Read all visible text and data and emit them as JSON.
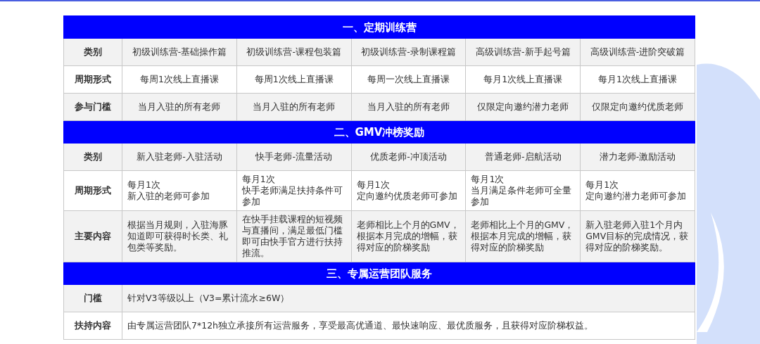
{
  "sections": [
    {
      "title": "一、定期训练营",
      "rows": [
        {
          "label": "类别",
          "kind": "centered",
          "cells": [
            "初级训练营-基础操作篇",
            "初级训练营-课程包装篇",
            "初级训练营-录制课程篇",
            "高级训练营-新手起号篇",
            "高级训练营-进阶突破篇"
          ]
        },
        {
          "label": "周期形式",
          "kind": "centered",
          "cells": [
            "每周1次线上直播课",
            "每周1次线上直播课",
            "每周一次线上直播课",
            "每月1次线上直播课",
            "每月1次线上直播课"
          ]
        },
        {
          "label": "参与门槛",
          "kind": "centered",
          "cells": [
            "当月入驻的所有老师",
            "当月入驻的所有老师",
            "当月入驻的所有老师",
            "仅限定向邀约潜力老师",
            "仅限定向邀约优质老师"
          ]
        }
      ]
    },
    {
      "title": "二、GMV冲榜奖励",
      "rows": [
        {
          "label": "类别",
          "kind": "centered",
          "cells": [
            "新入驻老师-入驻活动",
            "快手老师-流量活动",
            "优质老师-冲顶活动",
            "普通老师-启航活动",
            "潜力老师-激励活动"
          ]
        },
        {
          "label": "周期形式",
          "kind": "left",
          "cells": [
            [
              "每月1次",
              "新入驻的老师可参加"
            ],
            [
              "每月1次",
              "快手老师满足扶持条件可参加"
            ],
            [
              "每月1次",
              "定向邀约优质老师可参加"
            ],
            [
              "每月1次",
              "当月满足条件老师可全量参加"
            ],
            [
              "每月1次",
              "定向邀约潜力老师可参加"
            ]
          ]
        },
        {
          "label": "主要内容",
          "kind": "left",
          "cells": [
            "根据当月规则，入驻海豚知道即可获得时长类、礼包类等奖励。",
            "在快手挂载课程的短视频与直播间，满足最低门槛即可由快手官方进行扶持推流。",
            "老师相比上个月的GMV，根据本月完成的增幅，获得对应的阶梯奖励",
            "老师相比上个月的GMV，根据本月完成的增幅，获得对应的阶梯奖励",
            "新入驻老师入驻1个月内GMV目标的完成情况，获得对应的阶梯奖励。"
          ]
        }
      ]
    },
    {
      "title": "三、专属运营团队服务",
      "rows": [
        {
          "label": "门槛",
          "kind": "left",
          "cells": [
            "针对V3等级以上（V3=累计流水≥6W）"
          ]
        },
        {
          "label": "扶持内容",
          "kind": "left",
          "cells": [
            "由专属运营团队7*12h独立承接所有运营服务，享受最高优通道、最快速响应、最优质服务，且获得对应阶梯权益。"
          ]
        }
      ]
    }
  ]
}
